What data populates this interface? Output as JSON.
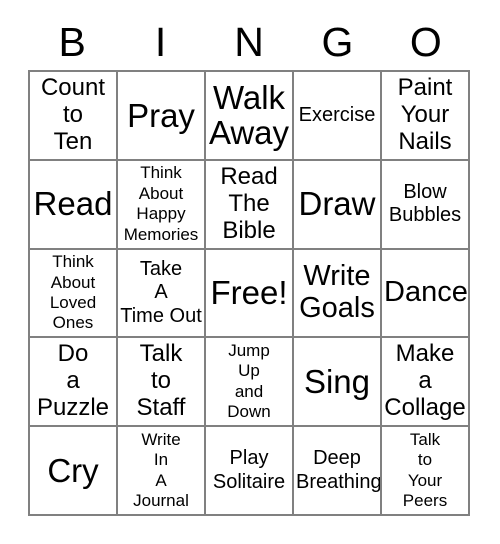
{
  "card": {
    "header_letters": [
      "B",
      "I",
      "N",
      "G",
      "O"
    ],
    "free_space_label": "Free!",
    "border_color": "#808080",
    "text_color": "#000000",
    "background_color": "#ffffff",
    "rows": [
      [
        {
          "text": "Count\nto\nTen",
          "size": "fs-md"
        },
        {
          "text": "Pray",
          "size": "fs-xl"
        },
        {
          "text": "Walk\nAway",
          "size": "fs-xl"
        },
        {
          "text": "Exercise",
          "size": "fs-sm"
        },
        {
          "text": "Paint\nYour\nNails",
          "size": "fs-md"
        }
      ],
      [
        {
          "text": "Read",
          "size": "fs-xl"
        },
        {
          "text": "Think\nAbout\nHappy\nMemories",
          "size": "fs-xs"
        },
        {
          "text": "Read\nThe\nBible",
          "size": "fs-md"
        },
        {
          "text": "Draw",
          "size": "fs-xl"
        },
        {
          "text": "Blow\nBubbles",
          "size": "fs-sm"
        }
      ],
      [
        {
          "text": "Think\nAbout\nLoved\nOnes",
          "size": "fs-xs"
        },
        {
          "text": "Take\nA\nTime Out",
          "size": "fs-sm"
        },
        {
          "text": "Free!",
          "size": "fs-xl"
        },
        {
          "text": "Write\nGoals",
          "size": "fs-lg"
        },
        {
          "text": "Dance",
          "size": "fs-lg"
        }
      ],
      [
        {
          "text": "Do\na\nPuzzle",
          "size": "fs-md"
        },
        {
          "text": "Talk\nto\nStaff",
          "size": "fs-md"
        },
        {
          "text": "Jump\nUp\nand\nDown",
          "size": "fs-xs"
        },
        {
          "text": "Sing",
          "size": "fs-xl"
        },
        {
          "text": "Make\na\nCollage",
          "size": "fs-md"
        }
      ],
      [
        {
          "text": "Cry",
          "size": "fs-xl"
        },
        {
          "text": "Write\nIn\nA\nJournal",
          "size": "fs-xs"
        },
        {
          "text": "Play\nSolitaire",
          "size": "fs-sm"
        },
        {
          "text": "Deep\nBreathing",
          "size": "fs-sm"
        },
        {
          "text": "Talk\nto\nYour\nPeers",
          "size": "fs-xs"
        }
      ]
    ]
  }
}
